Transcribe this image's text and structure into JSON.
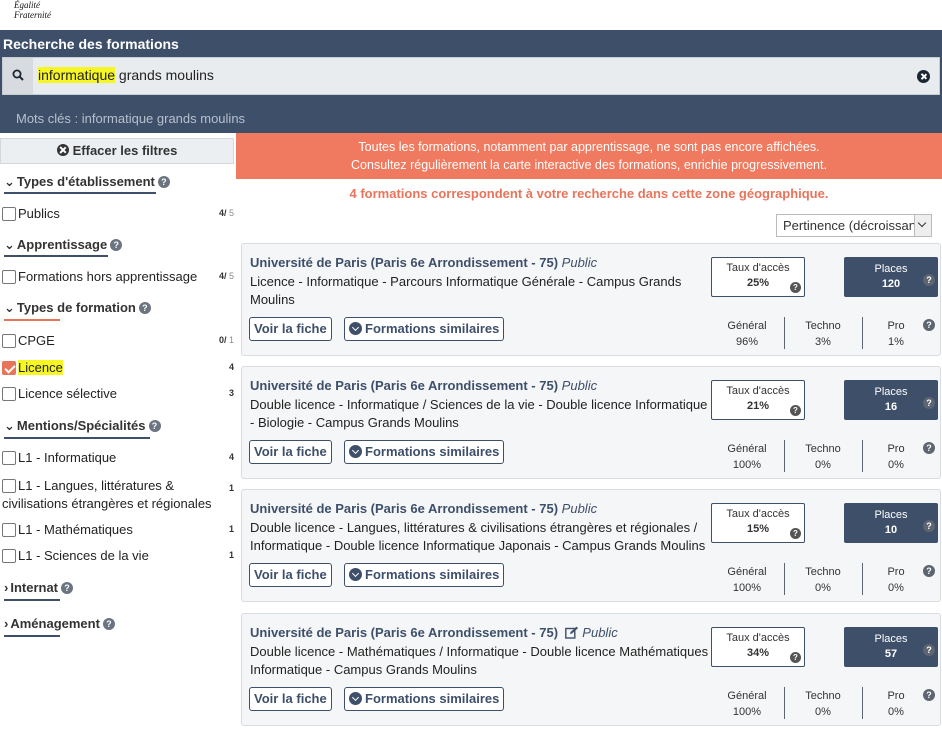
{
  "logo": {
    "line1": "Égalité",
    "line2": "Fraternité"
  },
  "header": {
    "title": "Recherche des formations",
    "search_value_hl": "informatique",
    "search_value_rest": " grands moulins",
    "keywords": "Mots clés : informatique grands moulins"
  },
  "sidebar": {
    "clear_filters": "Effacer les filtres",
    "sections": {
      "etablissement": "Types d'établissement",
      "apprentissage": "Apprentissage",
      "formation": "Types de formation",
      "mentions": "Mentions/Spécialités",
      "internat": "Internat",
      "amenagement": "Aménagement"
    },
    "items": {
      "publics": {
        "label": "Publics",
        "count": "4",
        "total": "5"
      },
      "hors_app": {
        "label": "Formations hors apprentissage",
        "count": "4",
        "total": "5"
      },
      "cpge": {
        "label": "CPGE",
        "count": "0",
        "total": "1"
      },
      "licence": {
        "label": "Licence",
        "count": "4"
      },
      "licence_sel": {
        "label": "Licence sélective",
        "count": "3"
      },
      "l1_info": {
        "label": "L1 - Informatique",
        "count": "4"
      },
      "l1_langues": {
        "label": "L1 - Langues, littératures & civilisations étrangères et régionales",
        "count": "1"
      },
      "l1_maths": {
        "label": "L1 - Mathématiques",
        "count": "1"
      },
      "l1_sciences": {
        "label": "L1 - Sciences de la vie",
        "count": "1"
      }
    }
  },
  "main": {
    "banner_line1": "Toutes les formations, notamment par apprentissage, ne sont pas encore affichées.",
    "banner_line2": "Consultez régulièrement la carte interactive des formations, enrichie progressivement.",
    "result_count": "4 formations correspondent à votre recherche dans cette zone géographique.",
    "sort_value": "Pertinence (décroissant)",
    "btn_fiche": "Voir la fiche",
    "btn_similaires": "Formations similaires",
    "taux_label": "Taux d'accès",
    "places_label": "Places",
    "stat_labels": {
      "general": "Général",
      "techno": "Techno",
      "pro": "Pro"
    },
    "cards": [
      {
        "uni": "Université de Paris (Paris 6e Arrondissement - 75)",
        "status": "Public",
        "desc": "Licence - Informatique - Parcours Informatique Générale - Campus Grands Moulins",
        "taux": "25%",
        "places": "120",
        "general": "96%",
        "techno": "3%",
        "pro": "1%"
      },
      {
        "uni": "Université de Paris (Paris 6e Arrondissement - 75)",
        "status": "Public",
        "desc": "Double licence - Informatique / Sciences de la vie - Double licence Informatique - Biologie - Campus Grands Moulins",
        "taux": "21%",
        "places": "16",
        "general": "100%",
        "techno": "0%",
        "pro": "0%"
      },
      {
        "uni": "Université de Paris (Paris 6e Arrondissement - 75)",
        "status": "Public",
        "desc": "Double licence - Langues, littératures & civilisations étrangères et régionales / Informatique - Double licence Informatique Japonais - Campus Grands Moulins",
        "taux": "15%",
        "places": "10",
        "general": "100%",
        "techno": "0%",
        "pro": "0%"
      },
      {
        "uni": "Université de Paris (Paris 6e Arrondissement - 75)",
        "status": "Public",
        "desc": "Double licence - Mathématiques / Informatique - Double licence Mathématiques Informatique - Campus Grands Moulins",
        "taux": "34%",
        "places": "57",
        "general": "100%",
        "techno": "0%",
        "pro": "0%"
      }
    ]
  }
}
